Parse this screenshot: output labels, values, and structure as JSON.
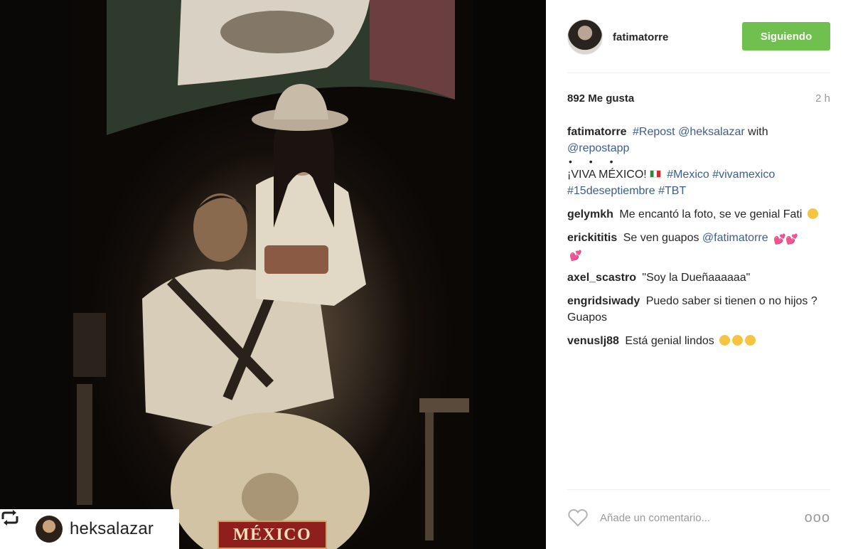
{
  "photo": {
    "repost_user": "heksalazar",
    "plate_text": "MÉXICO"
  },
  "post": {
    "author": "fatimatorre",
    "follow_label": "Siguiendo",
    "likes": "892 Me gusta",
    "time_ago": "2 h"
  },
  "caption": {
    "user": "fatimatorre",
    "tag_repost": "#Repost",
    "mention_1": "@heksalazar",
    "with": "with",
    "mention_2": "@repostapp",
    "dots": "• • •",
    "viva": "¡VIVA MÉXICO!",
    "tag_mexico": "#Mexico",
    "tag_vivamexico": "#vivamexico",
    "tag_15": "#15deseptiembre",
    "tag_tbt": "#TBT"
  },
  "comments": [
    {
      "user": "gelymkh",
      "text": "Me encantó la foto, se ve genial Fati"
    },
    {
      "user": "erickititis",
      "text": "Se ven guapos",
      "mention": "@fatimatorre"
    },
    {
      "user": "axel_scastro",
      "text": "\"Soy la Dueñaaaaaa\""
    },
    {
      "user": "engridsiwady",
      "text": "Puedo saber si tienen o no hijos ? Guapos"
    },
    {
      "user": "venuslj88",
      "text": "Está genial lindos"
    }
  ],
  "add_comment": {
    "placeholder": "Añade un comentario...",
    "more": "ooo"
  },
  "colors": {
    "follow_green": "#70c050",
    "link_blue": "#3b5e8c"
  },
  "icons": {
    "like": "heart-outline-icon",
    "repost": "repost-arrows-icon",
    "options": "more-dots-icon"
  }
}
